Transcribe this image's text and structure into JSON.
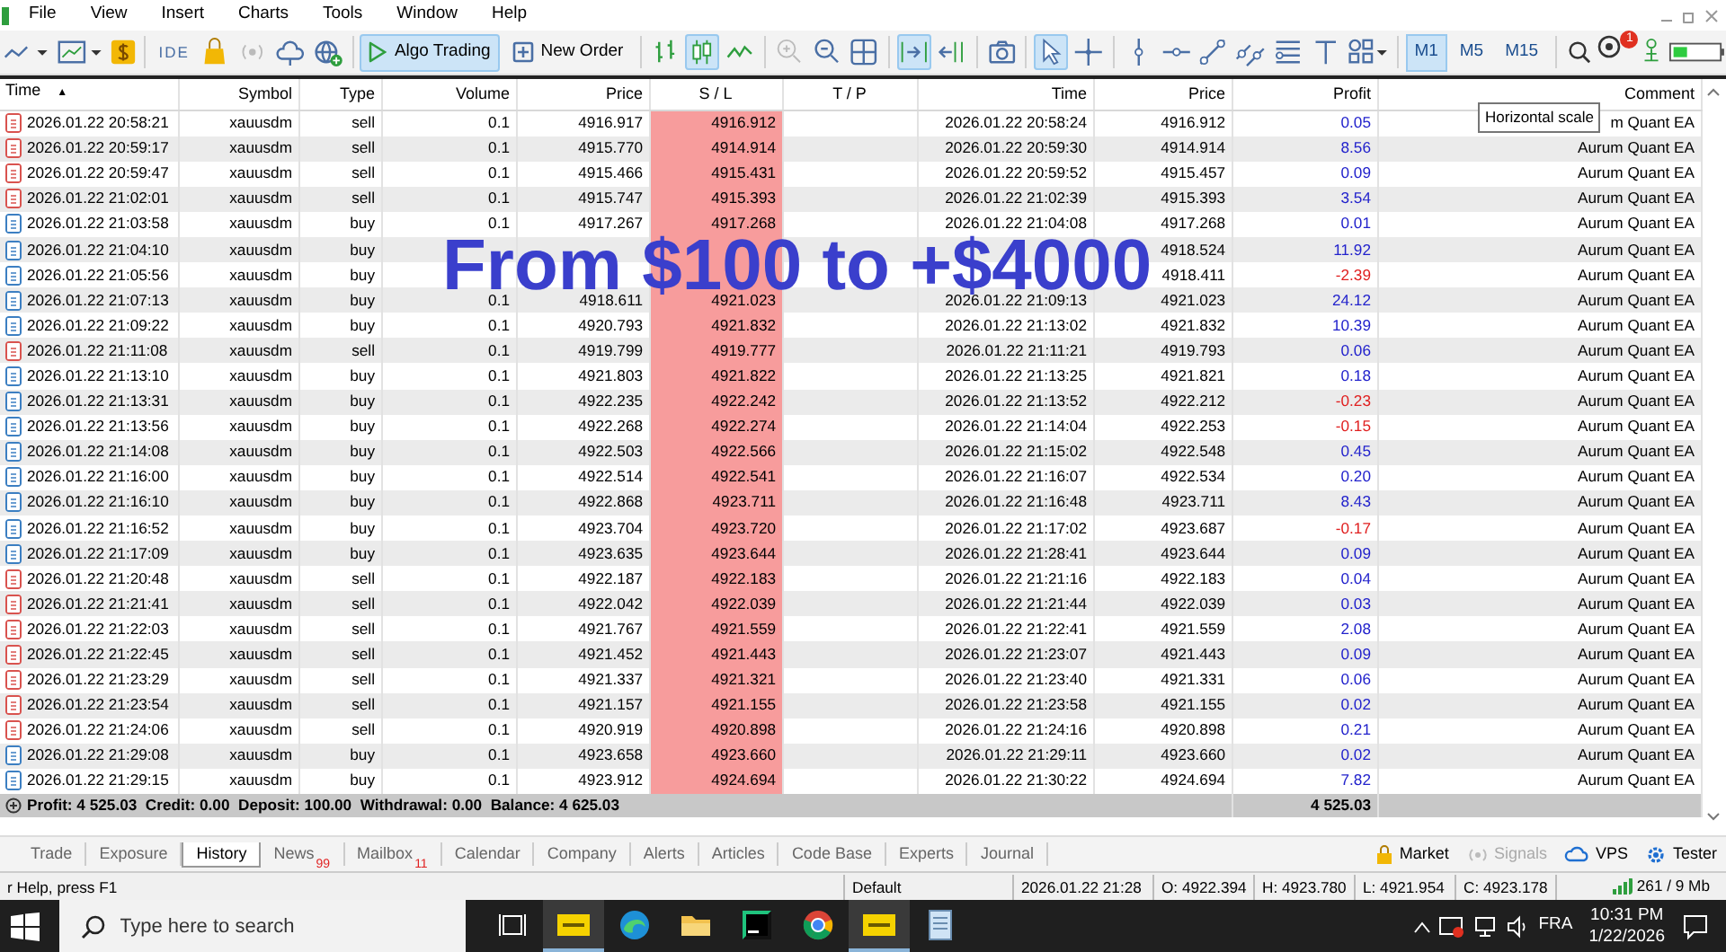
{
  "menu": [
    "File",
    "View",
    "Insert",
    "Charts",
    "Tools",
    "Window",
    "Help"
  ],
  "toolbar": {
    "ide_label": "IDE",
    "algo_trading": {
      "label": "Algo Trading",
      "on": true
    },
    "new_order": {
      "label": "New Order"
    },
    "chart_modes": [
      {
        "selected": false
      },
      {
        "selected": true
      },
      {
        "selected": false
      }
    ],
    "chart_scroll": [
      {
        "selected": true
      },
      {
        "selected": false
      }
    ],
    "pointer_tools": [
      {
        "selected": true
      },
      {
        "selected": false
      }
    ],
    "timeframes": [
      {
        "label": "M1",
        "selected": true
      },
      {
        "label": "M5",
        "selected": false
      },
      {
        "label": "M15",
        "selected": false
      }
    ],
    "notification_count": "1"
  },
  "table": {
    "columns": [
      {
        "label": "Time",
        "sort": "▲"
      },
      {
        "label": "Symbol"
      },
      {
        "label": "Type"
      },
      {
        "label": "Volume"
      },
      {
        "label": "Price"
      },
      {
        "label": "S / L"
      },
      {
        "label": "T / P"
      },
      {
        "label": "Time"
      },
      {
        "label": "Price"
      },
      {
        "label": "Profit"
      },
      {
        "label": "Comment"
      }
    ],
    "rows": [
      {
        "kind": "sell",
        "time": "2026.01.22 20:58:21",
        "symbol": "xauusdm",
        "type": "sell",
        "volume": "0.1",
        "price": "4916.917",
        "sl": "4916.912",
        "close_time": "2026.01.22 20:58:24",
        "close_price": "4916.912",
        "profit": "0.05",
        "loss": false,
        "comment": "m Quant EA"
      },
      {
        "kind": "sell",
        "time": "2026.01.22 20:59:17",
        "symbol": "xauusdm",
        "type": "sell",
        "volume": "0.1",
        "price": "4915.770",
        "sl": "4914.914",
        "close_time": "2026.01.22 20:59:30",
        "close_price": "4914.914",
        "profit": "8.56",
        "loss": false,
        "comment": "Aurum Quant EA"
      },
      {
        "kind": "sell",
        "time": "2026.01.22 20:59:47",
        "symbol": "xauusdm",
        "type": "sell",
        "volume": "0.1",
        "price": "4915.466",
        "sl": "4915.431",
        "close_time": "2026.01.22 20:59:52",
        "close_price": "4915.457",
        "profit": "0.09",
        "loss": false,
        "comment": "Aurum Quant EA"
      },
      {
        "kind": "sell",
        "time": "2026.01.22 21:02:01",
        "symbol": "xauusdm",
        "type": "sell",
        "volume": "0.1",
        "price": "4915.747",
        "sl": "4915.393",
        "close_time": "2026.01.22 21:02:39",
        "close_price": "4915.393",
        "profit": "3.54",
        "loss": false,
        "comment": "Aurum Quant EA"
      },
      {
        "kind": "buy",
        "time": "2026.01.22 21:03:58",
        "symbol": "xauusdm",
        "type": "buy",
        "volume": "0.1",
        "price": "4917.267",
        "sl": "4917.268",
        "close_time": "2026.01.22 21:04:08",
        "close_price": "4917.268",
        "profit": "0.01",
        "loss": false,
        "comment": "Aurum Quant EA"
      },
      {
        "kind": "buy",
        "time": "2026.01.22 21:04:10",
        "symbol": "xauusdm",
        "type": "buy",
        "close_price": "4918.524",
        "profit": "11.92",
        "loss": false,
        "comment": "Aurum Quant EA"
      },
      {
        "kind": "buy",
        "time": "2026.01.22 21:05:56",
        "symbol": "xauusdm",
        "type": "buy",
        "close_price": "4918.411",
        "profit": "-2.39",
        "loss": true,
        "comment": "Aurum Quant EA"
      },
      {
        "kind": "buy",
        "time": "2026.01.22 21:07:13",
        "symbol": "xauusdm",
        "type": "buy",
        "volume": "0.1",
        "price": "4918.611",
        "sl": "4921.023",
        "close_time": "2026.01.22 21:09:13",
        "close_price": "4921.023",
        "profit": "24.12",
        "loss": false,
        "comment": "Aurum Quant EA"
      },
      {
        "kind": "buy",
        "time": "2026.01.22 21:09:22",
        "symbol": "xauusdm",
        "type": "buy",
        "volume": "0.1",
        "price": "4920.793",
        "sl": "4921.832",
        "close_time": "2026.01.22 21:13:02",
        "close_price": "4921.832",
        "profit": "10.39",
        "loss": false,
        "comment": "Aurum Quant EA"
      },
      {
        "kind": "sell",
        "time": "2026.01.22 21:11:08",
        "symbol": "xauusdm",
        "type": "sell",
        "volume": "0.1",
        "price": "4919.799",
        "sl": "4919.777",
        "close_time": "2026.01.22 21:11:21",
        "close_price": "4919.793",
        "profit": "0.06",
        "loss": false,
        "comment": "Aurum Quant EA"
      },
      {
        "kind": "buy",
        "time": "2026.01.22 21:13:10",
        "symbol": "xauusdm",
        "type": "buy",
        "volume": "0.1",
        "price": "4921.803",
        "sl": "4921.822",
        "close_time": "2026.01.22 21:13:25",
        "close_price": "4921.821",
        "profit": "0.18",
        "loss": false,
        "comment": "Aurum Quant EA"
      },
      {
        "kind": "buy",
        "time": "2026.01.22 21:13:31",
        "symbol": "xauusdm",
        "type": "buy",
        "volume": "0.1",
        "price": "4922.235",
        "sl": "4922.242",
        "close_time": "2026.01.22 21:13:52",
        "close_price": "4922.212",
        "profit": "-0.23",
        "loss": true,
        "comment": "Aurum Quant EA"
      },
      {
        "kind": "buy",
        "time": "2026.01.22 21:13:56",
        "symbol": "xauusdm",
        "type": "buy",
        "volume": "0.1",
        "price": "4922.268",
        "sl": "4922.274",
        "close_time": "2026.01.22 21:14:04",
        "close_price": "4922.253",
        "profit": "-0.15",
        "loss": true,
        "comment": "Aurum Quant EA"
      },
      {
        "kind": "buy",
        "time": "2026.01.22 21:14:08",
        "symbol": "xauusdm",
        "type": "buy",
        "volume": "0.1",
        "price": "4922.503",
        "sl": "4922.566",
        "close_time": "2026.01.22 21:15:02",
        "close_price": "4922.548",
        "profit": "0.45",
        "loss": false,
        "comment": "Aurum Quant EA"
      },
      {
        "kind": "buy",
        "time": "2026.01.22 21:16:00",
        "symbol": "xauusdm",
        "type": "buy",
        "volume": "0.1",
        "price": "4922.514",
        "sl": "4922.541",
        "close_time": "2026.01.22 21:16:07",
        "close_price": "4922.534",
        "profit": "0.20",
        "loss": false,
        "comment": "Aurum Quant EA"
      },
      {
        "kind": "buy",
        "time": "2026.01.22 21:16:10",
        "symbol": "xauusdm",
        "type": "buy",
        "volume": "0.1",
        "price": "4922.868",
        "sl": "4923.711",
        "close_time": "2026.01.22 21:16:48",
        "close_price": "4923.711",
        "profit": "8.43",
        "loss": false,
        "comment": "Aurum Quant EA"
      },
      {
        "kind": "buy",
        "time": "2026.01.22 21:16:52",
        "symbol": "xauusdm",
        "type": "buy",
        "volume": "0.1",
        "price": "4923.704",
        "sl": "4923.720",
        "close_time": "2026.01.22 21:17:02",
        "close_price": "4923.687",
        "profit": "-0.17",
        "loss": true,
        "comment": "Aurum Quant EA"
      },
      {
        "kind": "buy",
        "time": "2026.01.22 21:17:09",
        "symbol": "xauusdm",
        "type": "buy",
        "volume": "0.1",
        "price": "4923.635",
        "sl": "4923.644",
        "close_time": "2026.01.22 21:28:41",
        "close_price": "4923.644",
        "profit": "0.09",
        "loss": false,
        "comment": "Aurum Quant EA"
      },
      {
        "kind": "sell",
        "time": "2026.01.22 21:20:48",
        "symbol": "xauusdm",
        "type": "sell",
        "volume": "0.1",
        "price": "4922.187",
        "sl": "4922.183",
        "close_time": "2026.01.22 21:21:16",
        "close_price": "4922.183",
        "profit": "0.04",
        "loss": false,
        "comment": "Aurum Quant EA"
      },
      {
        "kind": "sell",
        "time": "2026.01.22 21:21:41",
        "symbol": "xauusdm",
        "type": "sell",
        "volume": "0.1",
        "price": "4922.042",
        "sl": "4922.039",
        "close_time": "2026.01.22 21:21:44",
        "close_price": "4922.039",
        "profit": "0.03",
        "loss": false,
        "comment": "Aurum Quant EA"
      },
      {
        "kind": "sell",
        "time": "2026.01.22 21:22:03",
        "symbol": "xauusdm",
        "type": "sell",
        "volume": "0.1",
        "price": "4921.767",
        "sl": "4921.559",
        "close_time": "2026.01.22 21:22:41",
        "close_price": "4921.559",
        "profit": "2.08",
        "loss": false,
        "comment": "Aurum Quant EA"
      },
      {
        "kind": "sell",
        "time": "2026.01.22 21:22:45",
        "symbol": "xauusdm",
        "type": "sell",
        "volume": "0.1",
        "price": "4921.452",
        "sl": "4921.443",
        "close_time": "2026.01.22 21:23:07",
        "close_price": "4921.443",
        "profit": "0.09",
        "loss": false,
        "comment": "Aurum Quant EA"
      },
      {
        "kind": "sell",
        "time": "2026.01.22 21:23:29",
        "symbol": "xauusdm",
        "type": "sell",
        "volume": "0.1",
        "price": "4921.337",
        "sl": "4921.321",
        "close_time": "2026.01.22 21:23:40",
        "close_price": "4921.331",
        "profit": "0.06",
        "loss": false,
        "comment": "Aurum Quant EA"
      },
      {
        "kind": "sell",
        "time": "2026.01.22 21:23:54",
        "symbol": "xauusdm",
        "type": "sell",
        "volume": "0.1",
        "price": "4921.157",
        "sl": "4921.155",
        "close_time": "2026.01.22 21:23:58",
        "close_price": "4921.155",
        "profit": "0.02",
        "loss": false,
        "comment": "Aurum Quant EA"
      },
      {
        "kind": "sell",
        "time": "2026.01.22 21:24:06",
        "symbol": "xauusdm",
        "type": "sell",
        "volume": "0.1",
        "price": "4920.919",
        "sl": "4920.898",
        "close_time": "2026.01.22 21:24:16",
        "close_price": "4920.898",
        "profit": "0.21",
        "loss": false,
        "comment": "Aurum Quant EA"
      },
      {
        "kind": "buy",
        "time": "2026.01.22 21:29:08",
        "symbol": "xauusdm",
        "type": "buy",
        "volume": "0.1",
        "price": "4923.658",
        "sl": "4923.660",
        "close_time": "2026.01.22 21:29:11",
        "close_price": "4923.660",
        "profit": "0.02",
        "loss": false,
        "comment": "Aurum Quant EA"
      },
      {
        "kind": "buy",
        "time": "2026.01.22 21:29:15",
        "symbol": "xauusdm",
        "type": "buy",
        "volume": "0.1",
        "price": "4923.912",
        "sl": "4924.694",
        "close_time": "2026.01.22 21:30:22",
        "close_price": "4924.694",
        "profit": "7.82",
        "loss": false,
        "comment": "Aurum Quant EA"
      }
    ],
    "summary": "Profit: 4 525.03  Credit: 0.00  Deposit: 100.00  Withdrawal: 0.00  Balance: 4 625.03",
    "total_profit": "4 525.03"
  },
  "overlay_text": "From $100 to +$4000",
  "tooltip": "Horizontal scale",
  "tabs": [
    {
      "label": "Trade",
      "selected": false
    },
    {
      "label": "Exposure",
      "selected": false
    },
    {
      "label": "History",
      "selected": true
    },
    {
      "label": "News",
      "selected": false,
      "badge": "99"
    },
    {
      "label": "Mailbox",
      "selected": false,
      "badge": "11"
    },
    {
      "label": "Calendar",
      "selected": false
    },
    {
      "label": "Company",
      "selected": false
    },
    {
      "label": "Alerts",
      "selected": false
    },
    {
      "label": "Articles",
      "selected": false
    },
    {
      "label": "Code Base",
      "selected": false
    },
    {
      "label": "Experts",
      "selected": false
    },
    {
      "label": "Journal",
      "selected": false
    }
  ],
  "services": [
    {
      "kind": "market",
      "label": "Market",
      "disabled": false
    },
    {
      "kind": "signals",
      "label": "Signals",
      "disabled": true
    },
    {
      "kind": "vps",
      "label": "VPS",
      "disabled": false
    },
    {
      "kind": "tester",
      "label": "Tester",
      "disabled": false
    }
  ],
  "status_bar": {
    "help": "r Help, press F1",
    "profile": "Default",
    "bar_time": "2026.01.22 21:28",
    "open": "O: 4922.394",
    "high": "H: 4923.780",
    "low": "L: 4921.954",
    "close": "C: 4923.178",
    "memory": "261 / 9 Mb"
  },
  "taskbar": {
    "search_placeholder": "Type here to search",
    "apps": [
      {
        "kind": "trader",
        "active": true
      },
      {
        "kind": "edge",
        "active": false
      },
      {
        "kind": "folder",
        "active": false
      },
      {
        "kind": "ide",
        "active": false
      },
      {
        "kind": "chrome",
        "active": false
      },
      {
        "kind": "trader",
        "active": true
      },
      {
        "kind": "notepad",
        "active": false
      }
    ],
    "language": "FRA",
    "time": "10:31 PM",
    "date": "1/22/2026"
  }
}
